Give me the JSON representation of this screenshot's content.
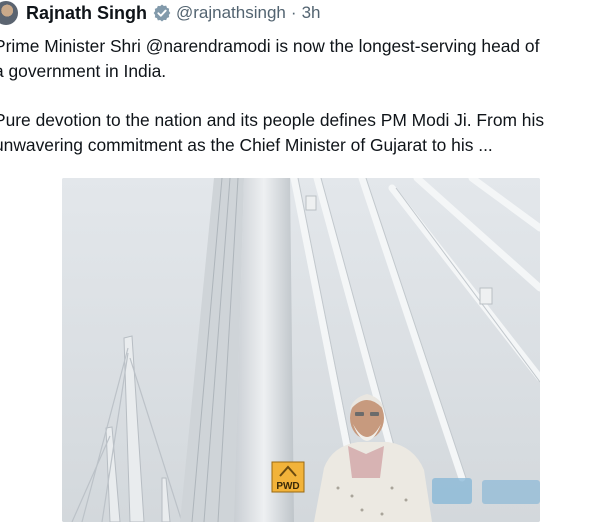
{
  "post": {
    "author_name": "Rajnath Singh",
    "author_handle": "@rajnathsingh",
    "separator": "·",
    "timestamp": "3h",
    "text_line_1": "Prime Minister Shri @narendramodi is now the longest-serving head of",
    "text_line_2": "a government in India.",
    "text_line_3": "Pure devotion to the nation and its people defines PM Modi Ji. From his",
    "text_line_4": "unwavering commitment as the Chief Minister of Gujarat to his ...",
    "image_sign_text": "PWD",
    "verified_badge_icon": "verified-badge-icon",
    "colors": {
      "name": "#0f1419",
      "secondary": "#536471",
      "verified_badge": "#829aab"
    }
  }
}
